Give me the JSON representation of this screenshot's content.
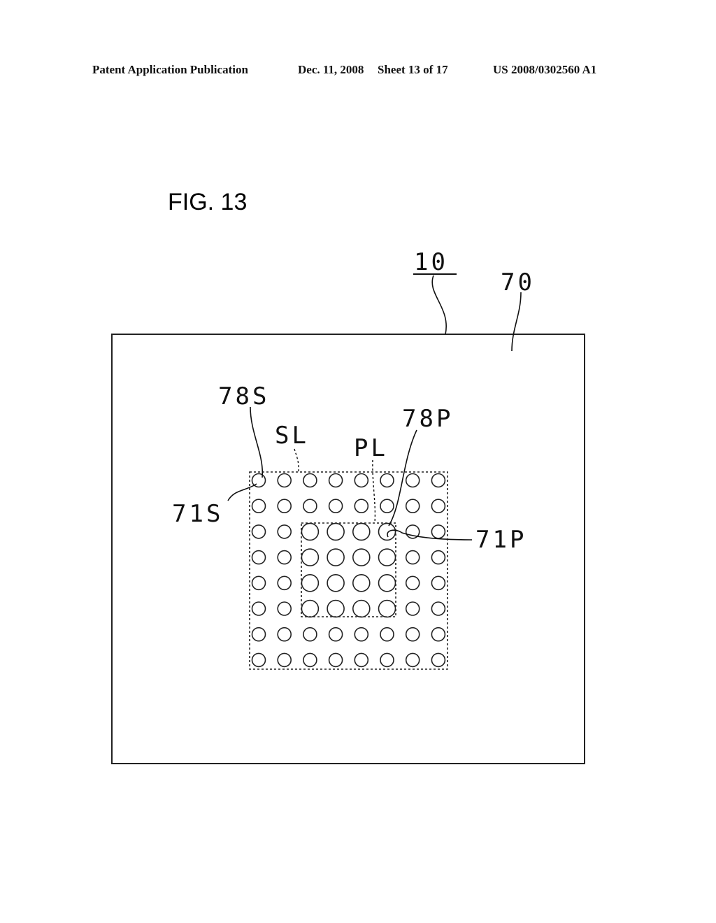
{
  "header": {
    "publication_type": "Patent Application Publication",
    "date": "Dec. 11, 2008",
    "sheet": "Sheet 13 of 17",
    "patent_number": "US 2008/0302560 A1"
  },
  "figure": {
    "title": "FIG. 13",
    "labels": {
      "device": "10",
      "substrate": "70",
      "small_pad_region_ref": "78S",
      "small_pad_region": "SL",
      "large_pad_region": "PL",
      "large_pad_region_ref": "78P",
      "small_pad": "71S",
      "large_pad": "71P"
    },
    "grid": {
      "rows": 8,
      "cols": 8,
      "large_region_rows": [
        2,
        5
      ],
      "large_region_cols": [
        2,
        5
      ]
    }
  }
}
